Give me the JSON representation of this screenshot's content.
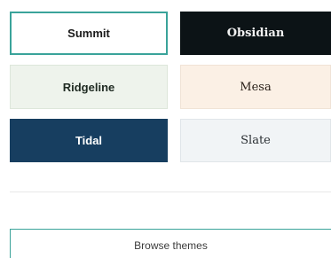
{
  "themes": [
    {
      "label": "Summit",
      "background": "#ffffff",
      "text_color": "#1a1a1a",
      "border": "#3aa39a",
      "selected": true
    },
    {
      "label": "Obsidian",
      "background": "#0c1316",
      "text_color": "#f2f2f2"
    },
    {
      "label": "Ridgeline",
      "background": "#eef3ec",
      "text_color": "#1f2a22"
    },
    {
      "label": "Mesa",
      "background": "#fbf0e5",
      "text_color": "#2a211a"
    },
    {
      "label": "Tidal",
      "background": "#173e60",
      "text_color": "#ffffff"
    },
    {
      "label": "Slate",
      "background": "#f1f4f6",
      "text_color": "#2a2f33"
    }
  ],
  "browse_button": {
    "label": "Browse themes",
    "border_color": "#3aa39a"
  }
}
